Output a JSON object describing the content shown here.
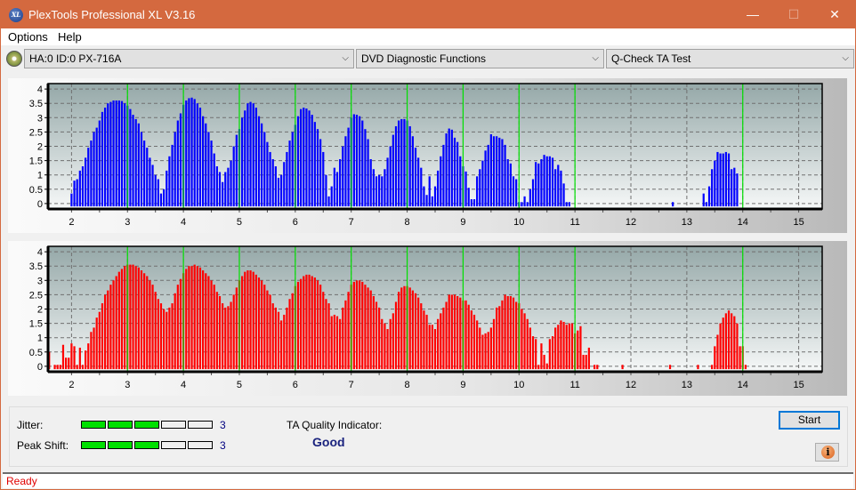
{
  "window": {
    "title": "PlexTools Professional XL V3.16",
    "app_icon_text": "XL",
    "min_glyph": "—",
    "max_glyph": "☐",
    "close_glyph": "✕"
  },
  "menu": [
    "Options",
    "Help"
  ],
  "toolbar": {
    "drive": "HA:0 ID:0  PX-716A",
    "function": "DVD Diagnostic Functions",
    "test": "Q-Check TA Test",
    "chevron": "⌵"
  },
  "colors": {
    "top_bars": "#0000ff",
    "bottom_bars": "#ff0000",
    "marker_lines": "#00e000",
    "title_bar": "#d4693f",
    "quality_text": "#1a237e",
    "status_text": "#e00000"
  },
  "chart_data": [
    {
      "type": "bar",
      "title": "",
      "xlabel": "",
      "ylabel": "",
      "x_start": 1.6,
      "x_step": 0.05,
      "xlim": [
        1.58,
        15.42
      ],
      "ylim": [
        -0.19,
        4.19
      ],
      "x_ticks": [
        2,
        3,
        4,
        5,
        6,
        7,
        8,
        9,
        10,
        11,
        12,
        13,
        14,
        15
      ],
      "y_ticks": [
        0,
        0.5,
        1,
        1.5,
        2,
        2.5,
        3,
        3.5,
        4
      ],
      "y_tick_labels": [
        "0",
        "0.5",
        "1",
        "1.5",
        "2",
        "2.5",
        "3",
        "3.5",
        "4"
      ],
      "marker_lines": [
        3,
        4,
        5,
        6,
        7,
        8,
        9,
        10,
        11,
        14
      ],
      "grid": true,
      "series": [
        {
          "name": "top",
          "color": "#0000ff",
          "values": [
            0,
            0,
            0,
            0,
            0,
            0,
            0,
            0,
            0.35,
            0.8,
            0.85,
            1.15,
            1.3,
            1.6,
            1.95,
            2.2,
            2.5,
            2.65,
            2.9,
            3.2,
            3.35,
            3.5,
            3.55,
            3.6,
            3.6,
            3.6,
            3.58,
            3.5,
            3.42,
            3.3,
            3.1,
            2.95,
            2.8,
            2.5,
            2.2,
            1.95,
            1.6,
            1.35,
            1.0,
            0.85,
            0.35,
            0.5,
            1.15,
            1.65,
            2.05,
            2.5,
            2.9,
            3.15,
            3.45,
            3.6,
            3.68,
            3.7,
            3.65,
            3.5,
            3.35,
            3.05,
            2.8,
            2.5,
            2.2,
            1.75,
            1.3,
            1.1,
            0.75,
            1.1,
            1.25,
            1.5,
            2.0,
            2.4,
            2.6,
            3.0,
            3.25,
            3.5,
            3.55,
            3.5,
            3.35,
            3.05,
            2.8,
            2.5,
            2.15,
            1.8,
            1.55,
            1.3,
            0.9,
            1.0,
            1.45,
            1.8,
            2.2,
            2.5,
            2.75,
            3.05,
            3.3,
            3.35,
            3.32,
            3.25,
            3.1,
            2.85,
            2.6,
            2.25,
            1.8,
            1.0,
            0.25,
            0.6,
            1.25,
            1.1,
            1.55,
            2.0,
            2.35,
            2.65,
            3.0,
            3.12,
            3.1,
            3.05,
            2.9,
            2.6,
            2.25,
            1.55,
            1.2,
            0.95,
            1.0,
            0.95,
            1.2,
            1.6,
            2.0,
            2.4,
            2.7,
            2.9,
            2.95,
            2.95,
            2.9,
            2.7,
            2.35,
            1.95,
            1.6,
            1.25,
            0.6,
            0.3,
            0.95,
            0.25,
            0.6,
            1.15,
            1.65,
            2.05,
            2.45,
            2.62,
            2.58,
            2.3,
            2.15,
            1.65,
            1.3,
            1.12,
            0.55,
            0.15,
            0.15,
            0.95,
            1.2,
            1.5,
            1.85,
            2.05,
            2.42,
            2.35,
            2.35,
            2.3,
            2.25,
            2.05,
            1.55,
            1.4,
            0.95,
            0.85,
            0.05,
            0.05,
            0.25,
            0.05,
            0.5,
            0.85,
            1.45,
            1.4,
            1.55,
            1.7,
            1.65,
            1.65,
            1.6,
            1.2,
            1.35,
            1.15,
            0.7,
            0.05,
            0.05,
            0,
            0,
            0,
            0,
            0,
            0,
            0,
            0,
            0,
            0,
            0,
            0,
            0,
            0,
            0,
            0,
            0,
            0,
            0,
            0,
            0,
            0,
            0,
            0,
            0,
            0,
            0,
            0,
            0,
            0,
            0,
            0,
            0,
            0,
            0,
            0,
            0.05,
            0,
            0,
            0,
            0,
            0,
            0,
            0,
            0,
            0,
            0,
            0.35,
            0.05,
            0.6,
            1.2,
            1.5,
            1.8,
            1.75,
            1.75,
            1.8,
            1.75,
            1.2,
            1.25,
            1.05,
            0,
            0,
            0,
            0,
            0,
            0,
            0,
            0,
            0,
            0,
            0,
            0,
            0,
            0,
            0,
            0,
            0,
            0,
            0,
            0,
            0
          ]
        }
      ]
    },
    {
      "type": "bar",
      "title": "",
      "xlabel": "",
      "ylabel": "",
      "x_start": 1.6,
      "x_step": 0.05,
      "xlim": [
        1.58,
        15.42
      ],
      "ylim": [
        -0.19,
        4.19
      ],
      "x_ticks": [
        2,
        3,
        4,
        5,
        6,
        7,
        8,
        9,
        10,
        11,
        12,
        13,
        14,
        15
      ],
      "y_ticks": [
        0,
        0.5,
        1,
        1.5,
        2,
        2.5,
        3,
        3.5,
        4
      ],
      "y_tick_labels": [
        "0",
        "0.5",
        "1",
        "1.5",
        "2",
        "2.5",
        "3",
        "3.5",
        "4"
      ],
      "marker_lines": [
        3,
        4,
        5,
        6,
        7,
        8,
        9,
        10,
        11,
        14
      ],
      "grid": true,
      "series": [
        {
          "name": "bottom",
          "color": "#ff0000",
          "values": [
            0.5,
            0,
            0.05,
            0.05,
            0.05,
            0.75,
            0.3,
            0.3,
            0.8,
            0.7,
            0.05,
            0.65,
            0.05,
            0.55,
            0.8,
            1.2,
            1.35,
            1.7,
            1.9,
            2.2,
            2.5,
            2.65,
            2.85,
            3.0,
            3.15,
            3.3,
            3.4,
            3.5,
            3.55,
            3.55,
            3.55,
            3.5,
            3.45,
            3.35,
            3.25,
            3.15,
            3.0,
            2.85,
            2.6,
            2.35,
            2.2,
            2.0,
            1.9,
            2.05,
            2.2,
            2.55,
            2.85,
            3.05,
            3.25,
            3.4,
            3.5,
            3.5,
            3.55,
            3.5,
            3.45,
            3.35,
            3.25,
            3.15,
            3.0,
            2.85,
            2.6,
            2.45,
            2.2,
            2.05,
            2.1,
            2.25,
            2.5,
            2.75,
            3.0,
            3.15,
            3.3,
            3.35,
            3.35,
            3.3,
            3.2,
            3.1,
            3.0,
            2.85,
            2.65,
            2.5,
            2.2,
            2.05,
            1.9,
            1.6,
            1.8,
            2.05,
            2.35,
            2.55,
            2.8,
            2.95,
            3.05,
            3.15,
            3.2,
            3.2,
            3.15,
            3.1,
            3.0,
            2.85,
            2.6,
            2.35,
            2.2,
            1.75,
            1.8,
            1.75,
            1.65,
            2.05,
            2.3,
            2.6,
            2.85,
            2.95,
            3.0,
            3.0,
            2.95,
            2.85,
            2.75,
            2.65,
            2.45,
            2.25,
            2.05,
            1.65,
            1.5,
            1.3,
            1.65,
            1.85,
            2.25,
            2.6,
            2.75,
            2.8,
            2.8,
            2.75,
            2.65,
            2.55,
            2.4,
            2.2,
            1.95,
            1.8,
            1.45,
            1.45,
            1.3,
            1.65,
            1.85,
            2.05,
            2.25,
            2.5,
            2.5,
            2.5,
            2.45,
            2.4,
            2.3,
            2.3,
            2.15,
            1.95,
            1.8,
            1.6,
            1.35,
            1.1,
            1.15,
            1.2,
            1.35,
            1.65,
            2.05,
            2.1,
            2.3,
            2.5,
            2.45,
            2.45,
            2.4,
            2.25,
            2.2,
            2.0,
            1.85,
            1.65,
            1.35,
            1.05,
            0.95,
            0.05,
            0.8,
            0.4,
            0.1,
            0.95,
            1.05,
            1.35,
            1.45,
            1.6,
            1.55,
            1.45,
            1.5,
            1.5,
            1.15,
            1.25,
            1.4,
            0.4,
            0.4,
            0.65,
            0,
            0.05,
            0.05,
            0,
            0,
            0,
            0,
            0,
            0,
            0,
            0,
            0.05,
            0,
            0,
            0,
            0,
            0,
            0,
            0,
            0,
            0,
            0,
            0,
            0,
            0,
            0,
            0,
            0,
            0.05,
            0,
            0,
            0,
            0,
            0,
            0,
            0,
            0,
            0,
            0.05,
            0,
            0,
            0,
            0,
            0.05,
            0.7,
            1.1,
            1.5,
            1.7,
            1.85,
            1.95,
            1.85,
            1.75,
            1.5,
            0.7,
            0.7,
            0.05,
            0,
            0,
            0,
            0,
            0,
            0,
            0,
            0,
            0,
            0,
            0,
            0,
            0,
            0,
            0,
            0,
            0,
            0,
            0,
            0
          ]
        }
      ]
    }
  ],
  "metrics": {
    "jitter_label": "Jitter:",
    "jitter_value": "3",
    "jitter_level": 3,
    "jitter_max": 5,
    "peak_shift_label": "Peak Shift:",
    "peak_shift_value": "3",
    "peak_shift_level": 3,
    "peak_shift_max": 5,
    "ta_quality_label": "TA Quality Indicator:",
    "ta_quality_value": "Good"
  },
  "buttons": {
    "start": "Start",
    "info_glyph": "i"
  },
  "status": "Ready"
}
